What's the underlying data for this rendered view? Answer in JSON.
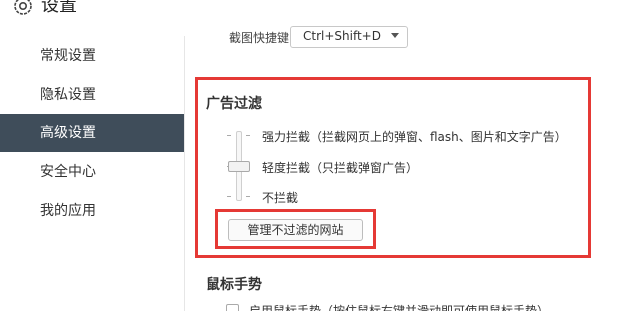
{
  "header": {
    "title": "设置",
    "icon": "gear-icon"
  },
  "sidebar": {
    "items": [
      {
        "label": "常规设置",
        "active": false
      },
      {
        "label": "隐私设置",
        "active": false
      },
      {
        "label": "高级设置",
        "active": true
      },
      {
        "label": "安全中心",
        "active": false
      },
      {
        "label": "我的应用",
        "active": false
      }
    ]
  },
  "shortcut": {
    "label": "截图快捷键",
    "value": "Ctrl+Shift+D"
  },
  "ad_filter": {
    "title": "广告过滤",
    "options": [
      "强力拦截（拦截网页上的弹窗、flash、图片和文字广告）",
      "轻度拦截（只拦截弹窗广告）",
      "不拦截"
    ],
    "selected_index": 1,
    "manage_button": "管理不过滤的网站"
  },
  "mouse_gesture": {
    "title": "鼠标手势",
    "option": "启用鼠标手势（按住鼠标右键并滑动即可使用鼠标手势）"
  },
  "colors": {
    "sidebar_active_bg": "#3f4d5a",
    "highlight": "#e53935"
  }
}
